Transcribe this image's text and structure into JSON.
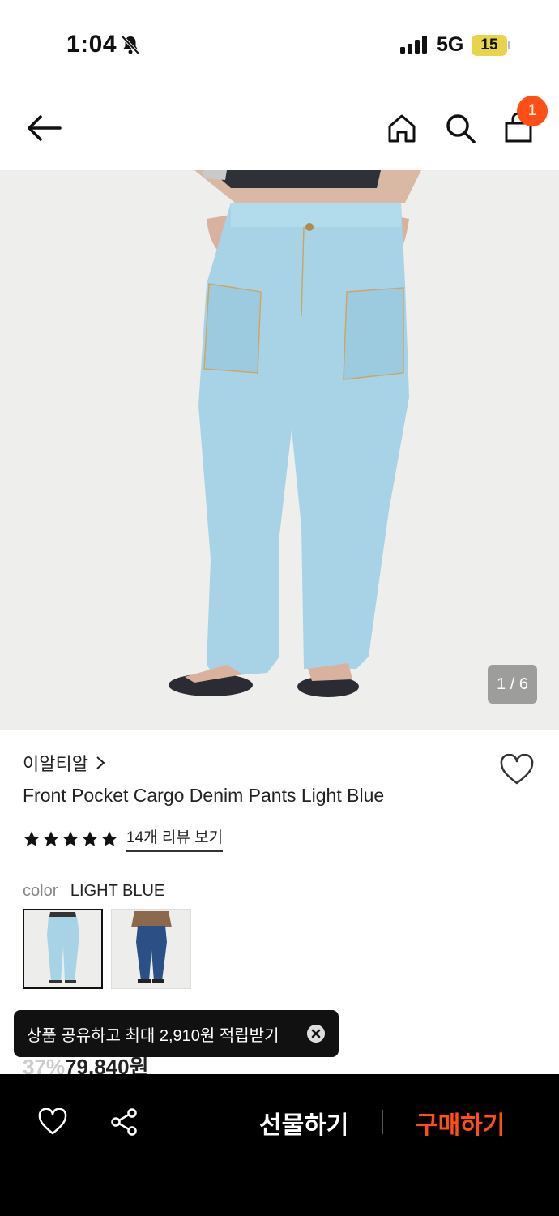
{
  "status_bar": {
    "time": "1:04",
    "network": "5G",
    "battery": "15"
  },
  "nav": {
    "cart_count": "1"
  },
  "gallery": {
    "counter": "1 / 6"
  },
  "product": {
    "brand": "이알티알",
    "title": "Front Pocket Cargo Denim Pants Light Blue",
    "rating_stars": 5,
    "review_link": "14개 리뷰 보기",
    "color_label": "color",
    "color_value": "LIGHT BLUE",
    "discount": "37%",
    "price": "79,840원"
  },
  "toast": {
    "message": "상품 공유하고 최대 2,910원 적립받기"
  },
  "bottom_bar": {
    "gift_label": "선물하기",
    "buy_label": "구매하기"
  },
  "colors": {
    "accent": "#ff4f17",
    "bottom_bar_bg": "#000000"
  }
}
